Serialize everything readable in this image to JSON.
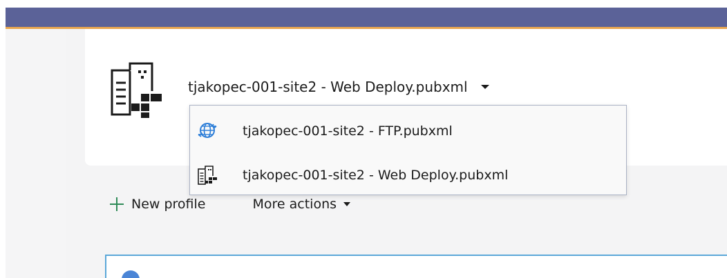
{
  "colors": {
    "title_bar": "#5b6298",
    "title_bar_accent": "#e9a64f",
    "new_profile_plus": "#2e8b57",
    "info_panel_border": "#5aa7d8",
    "globe_icon": "#2f7fd8"
  },
  "profile": {
    "selected": "tjakopec-001-site2 - Web Deploy.pubxml",
    "icon": "web-deploy-server-icon"
  },
  "dropdown": {
    "items": [
      {
        "label": "tjakopec-001-site2 - FTP.pubxml",
        "icon": "globe-sync-icon"
      },
      {
        "label": "tjakopec-001-site2 - Web Deploy.pubxml",
        "icon": "web-deploy-server-icon"
      }
    ]
  },
  "actions": {
    "new_profile": "New profile",
    "more_actions": "More actions"
  }
}
